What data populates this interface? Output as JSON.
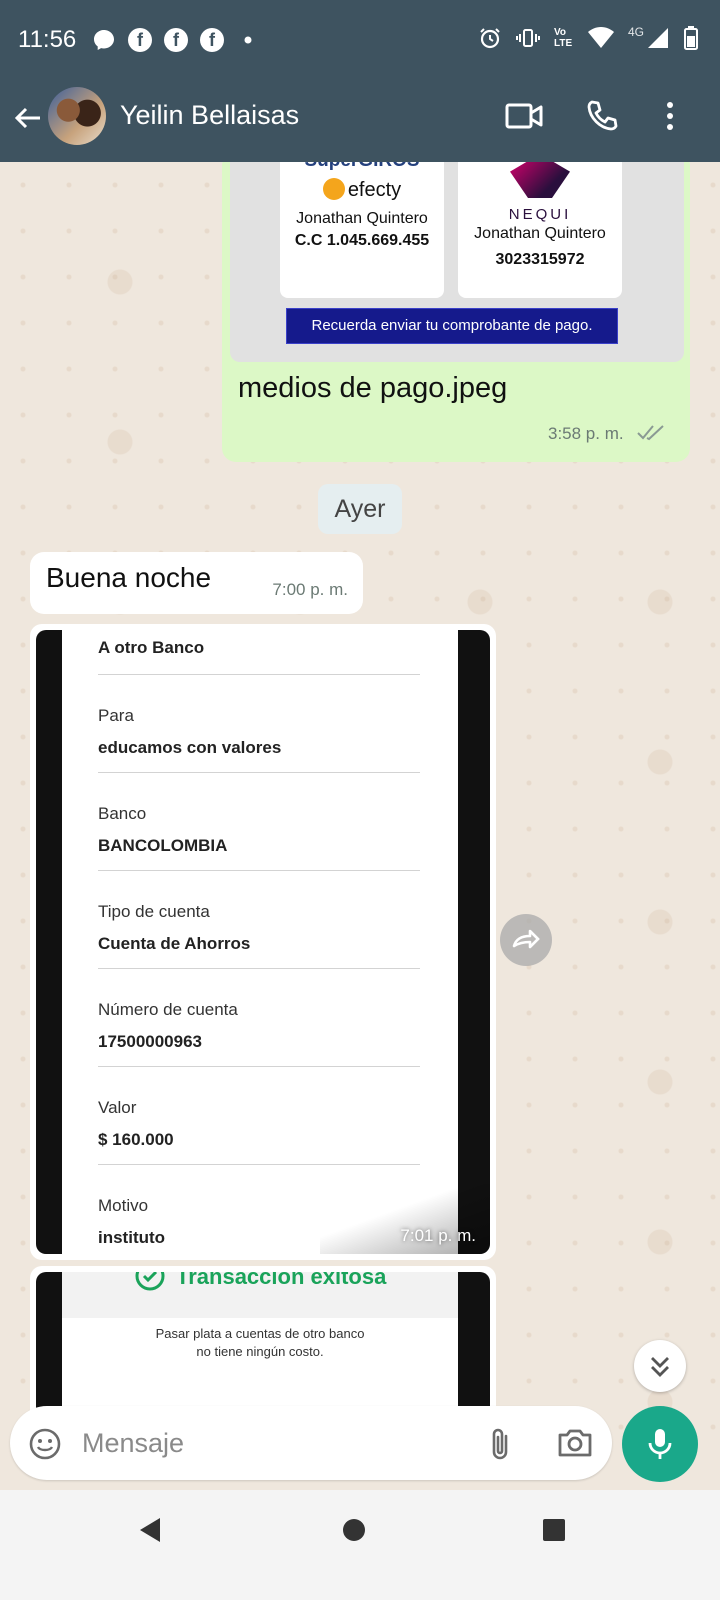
{
  "status_bar": {
    "time": "11:56",
    "network": "4G",
    "volte": "Vo LTE"
  },
  "header": {
    "contact_name": "Yeilin Bellaisas"
  },
  "outgoing_image_message": {
    "card1": {
      "brand_supergiros": "SuperGIROS",
      "brand_efecty": "efecty",
      "name": "Jonathan Quintero",
      "id_number": "C.C 1.045.669.455"
    },
    "card2": {
      "brand": "NEQUI",
      "name": "Jonathan Quintero",
      "phone": "3023315972"
    },
    "reminder": "Recuerda enviar tu comprobante de pago.",
    "filename": "medios de pago.jpeg",
    "time": "3:58 p. m."
  },
  "date_divider": "Ayer",
  "incoming_text_message": {
    "text": "Buena noche",
    "time": "7:00 p. m."
  },
  "receipt_message": {
    "first_value": "A otro Banco",
    "fields": [
      {
        "label": "Para",
        "value": "educamos con valores"
      },
      {
        "label": "Banco",
        "value": "BANCOLOMBIA"
      },
      {
        "label": "Tipo de cuenta",
        "value": "Cuenta de Ahorros"
      },
      {
        "label": "Número de cuenta",
        "value": "17500000963"
      },
      {
        "label": "Valor",
        "value": "$ 160.000"
      },
      {
        "label": "Motivo",
        "value": "instituto"
      }
    ],
    "time": "7:01 p. m."
  },
  "receipt_message_2": {
    "title": "Transacción exitosa",
    "line1": "Pasar plata a cuentas de otro banco",
    "line2": "no tiene ningún costo."
  },
  "composer": {
    "placeholder": "Mensaje"
  },
  "colors": {
    "header_bg": "#3e5360",
    "outgoing_bubble": "#dcf8c6",
    "mic_button": "#1aa88a"
  }
}
